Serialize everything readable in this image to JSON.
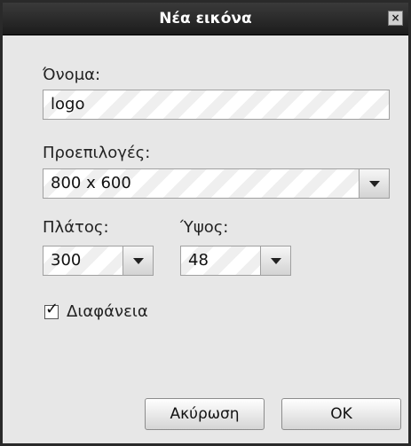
{
  "dialog": {
    "title": "Νέα εικόνα",
    "close_symbol": "×"
  },
  "name": {
    "label": "Όνομα:",
    "value": "logo"
  },
  "presets": {
    "label": "Προεπιλογές:",
    "value": "800 x 600"
  },
  "width": {
    "label": "Πλάτος:",
    "value": "300"
  },
  "height": {
    "label": "Ύψος:",
    "value": "48"
  },
  "transparency": {
    "label": "Διαφάνεια",
    "checked": true,
    "check_symbol": "✓"
  },
  "buttons": {
    "cancel": "Ακύρωση",
    "ok": "OK"
  },
  "icons": {
    "close": "close-icon",
    "dropdown": "chevron-down-icon",
    "check": "checkmark-icon"
  }
}
